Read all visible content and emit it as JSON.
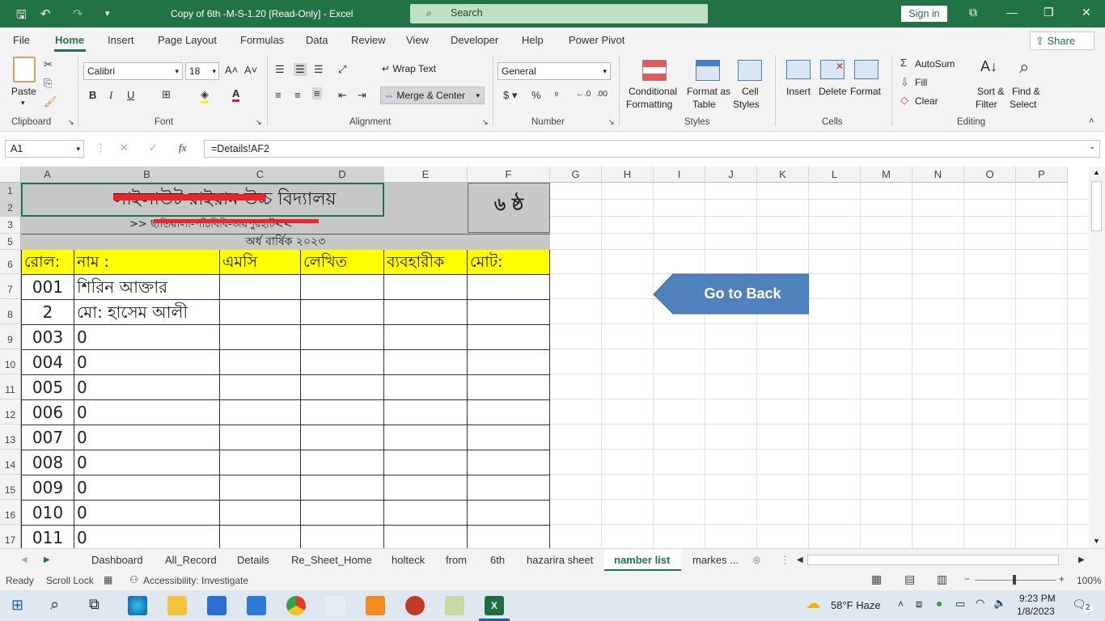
{
  "title_bar": {
    "title": "Copy of 6th -M-S-1.20  [Read-Only]  -  Excel",
    "search_placeholder": "Search",
    "sign_in": "Sign in"
  },
  "menu_tabs": [
    "File",
    "Home",
    "Insert",
    "Page Layout",
    "Formulas",
    "Data",
    "Review",
    "View",
    "Developer",
    "Help",
    "Power Pivot"
  ],
  "share_label": "Share",
  "ribbon": {
    "clipboard": {
      "paste": "Paste",
      "group": "Clipboard"
    },
    "font": {
      "name": "Calibri",
      "size": "18",
      "group": "Font",
      "bold": "B",
      "italic": "I",
      "underline": "U"
    },
    "alignment": {
      "wrap_text": "Wrap Text",
      "merge_center": "Merge & Center",
      "group": "Alignment"
    },
    "number": {
      "format": "General",
      "group": "Number"
    },
    "styles": {
      "conditional_1": "Conditional",
      "conditional_2": "Formatting",
      "format_table_1": "Format as",
      "format_table_2": "Table",
      "cell_styles_1": "Cell",
      "cell_styles_2": "Styles",
      "group": "Styles"
    },
    "cells": {
      "insert": "Insert",
      "delete": "Delete",
      "format": "Format",
      "group": "Cells"
    },
    "editing": {
      "autosum": "AutoSum",
      "fill": "Fill",
      "clear": "Clear",
      "sort_1": "Sort &",
      "sort_2": "Filter",
      "find_1": "Find &",
      "find_2": "Select",
      "group": "Editing"
    }
  },
  "formula_bar": {
    "name_box": "A1",
    "formula": "=Details!AF2",
    "fx": "fx"
  },
  "columns": [
    "A",
    "B",
    "C",
    "D",
    "E",
    "F",
    "G",
    "H",
    "I",
    "J",
    "K",
    "L",
    "M",
    "N",
    "O",
    "P"
  ],
  "row_numbers": [
    "1",
    "2",
    "3",
    "5",
    "6",
    "7",
    "8",
    "9",
    "10",
    "11",
    "12",
    "13",
    "14",
    "15",
    "16",
    "17"
  ],
  "sheet": {
    "school_name": "লাইলাউট রাইয়াম উচ্চ বিদ্যালয়",
    "class_label": "৬ ষ্ঠ",
    "address": ">> ছাতিয়ালা-পাঁচবিবি-জয়পুরহাট<<",
    "exam": "অর্ধ বার্ষিক ২০২৩",
    "headers": [
      "রোল:",
      "নাম :",
      "এমসি",
      "লেখিত",
      "ব্যবহারীক",
      "মোট:"
    ],
    "rows": [
      {
        "roll": "001",
        "name": "শিরিন আক্তার"
      },
      {
        "roll": "2",
        "name": "মো: হাসেম আলী"
      },
      {
        "roll": "003",
        "name": "0"
      },
      {
        "roll": "004",
        "name": "0"
      },
      {
        "roll": "005",
        "name": "0"
      },
      {
        "roll": "006",
        "name": "0"
      },
      {
        "roll": "007",
        "name": "0"
      },
      {
        "roll": "008",
        "name": "0"
      },
      {
        "roll": "009",
        "name": "0"
      },
      {
        "roll": "010",
        "name": "0"
      },
      {
        "roll": "011",
        "name": "0"
      }
    ],
    "go_back": "Go to Back"
  },
  "sheet_tabs": [
    "Dashboard",
    "All_Record",
    "Details",
    "Re_Sheet_Home",
    "holteck",
    "from",
    "6th",
    "hazarira sheet",
    "namber list",
    "markes ..."
  ],
  "active_sheet": "namber list",
  "status": {
    "ready": "Ready",
    "scroll_lock": "Scroll Lock",
    "accessibility": "Accessibility: Investigate",
    "zoom": "100%"
  },
  "taskbar": {
    "weather": "58°F  Haze",
    "time": "9:23 PM",
    "date": "1/8/2023",
    "notifications": "2"
  }
}
